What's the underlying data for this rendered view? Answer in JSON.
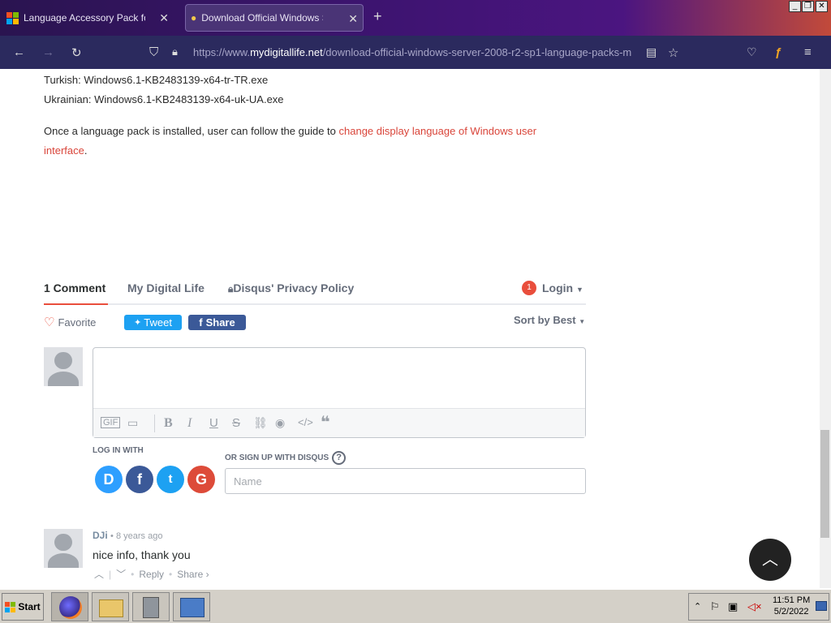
{
  "browser": {
    "tabs": [
      {
        "title": "Language Accessory Pack for Offic"
      },
      {
        "title": "Download Official Windows Server"
      }
    ],
    "url_prefix": "https://www.",
    "url_domain": "mydigitallife.net",
    "url_path": "/download-official-windows-server-2008-r2-sp1-language-packs-m"
  },
  "article": {
    "line1": "Turkish: Windows6.1-KB2483139-x64-tr-TR.exe",
    "line2": "Ukrainian: Windows6.1-KB2483139-x64-uk-UA.exe",
    "para_text": "Once a language pack is installed, user can follow the guide to ",
    "para_link": "change display language of Windows user interface",
    "para_end": "."
  },
  "disqus": {
    "tabs": [
      "1 Comment",
      "My Digital Life",
      "Disqus' Privacy Policy"
    ],
    "login_badge": "1",
    "login": "Login",
    "favorite": "Favorite",
    "tweet": "Tweet",
    "share": "Share",
    "sort": "Sort by Best",
    "login_with": "LOG IN WITH",
    "signup": "OR SIGN UP WITH DISQUS",
    "name_placeholder": "Name",
    "social": [
      "D",
      "f",
      "t",
      "G"
    ],
    "comment": {
      "author": "DJi",
      "time": "8 years ago",
      "text": "nice info, thank you",
      "reply": "Reply",
      "share": "Share ›"
    }
  },
  "taskbar": {
    "start": "Start",
    "time": "11:51 PM",
    "date": "5/2/2022"
  },
  "colors": {
    "accent": "#e94e3c",
    "link": "#d9453a",
    "twitter": "#1da1f2",
    "facebook": "#3b5998"
  }
}
